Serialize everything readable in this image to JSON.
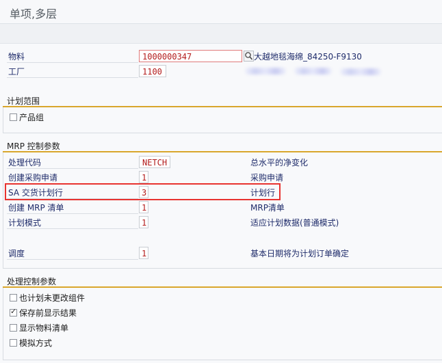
{
  "window": {
    "title": "单项,多层"
  },
  "material_row": {
    "label": "物料",
    "value": "1000000347",
    "description": "大越地毯海绵_84250-F9130",
    "search_icon": "magnifier-icon"
  },
  "plant_row": {
    "label": "工厂",
    "value": "1100"
  },
  "planning_scope": {
    "title": "计划范围",
    "product_group": {
      "label": "产品组",
      "checked": false
    }
  },
  "mrp_control": {
    "title": "MRP 控制参数",
    "rows": [
      {
        "label": "处理代码",
        "value": "NETCH",
        "description": "总水平的净变化"
      },
      {
        "label": "创建采购申请",
        "value": "1",
        "description": "采购申请"
      },
      {
        "label": "SA 交货计划行",
        "value": "3",
        "description": "计划行"
      },
      {
        "label": "创建 MRP 清单",
        "value": "1",
        "description": "MRP清单"
      },
      {
        "label": "计划模式",
        "value": "1",
        "description": "适应计划数据(普通模式)"
      },
      {
        "label": "调度",
        "value": "1",
        "description": "基本日期将为计划订单确定"
      }
    ],
    "highlight_color": "#e8322f"
  },
  "processing_control": {
    "title": "处理控制参数",
    "options": [
      {
        "label": "也计划未更改组件",
        "checked": false
      },
      {
        "label": "保存前显示结果",
        "checked": true
      },
      {
        "label": "显示物料清单",
        "checked": false
      },
      {
        "label": "模拟方式",
        "checked": false
      }
    ]
  },
  "colors": {
    "section_rule": "#d9a62b",
    "label_text": "#1e2b6a",
    "value_text": "#b31b1b"
  }
}
